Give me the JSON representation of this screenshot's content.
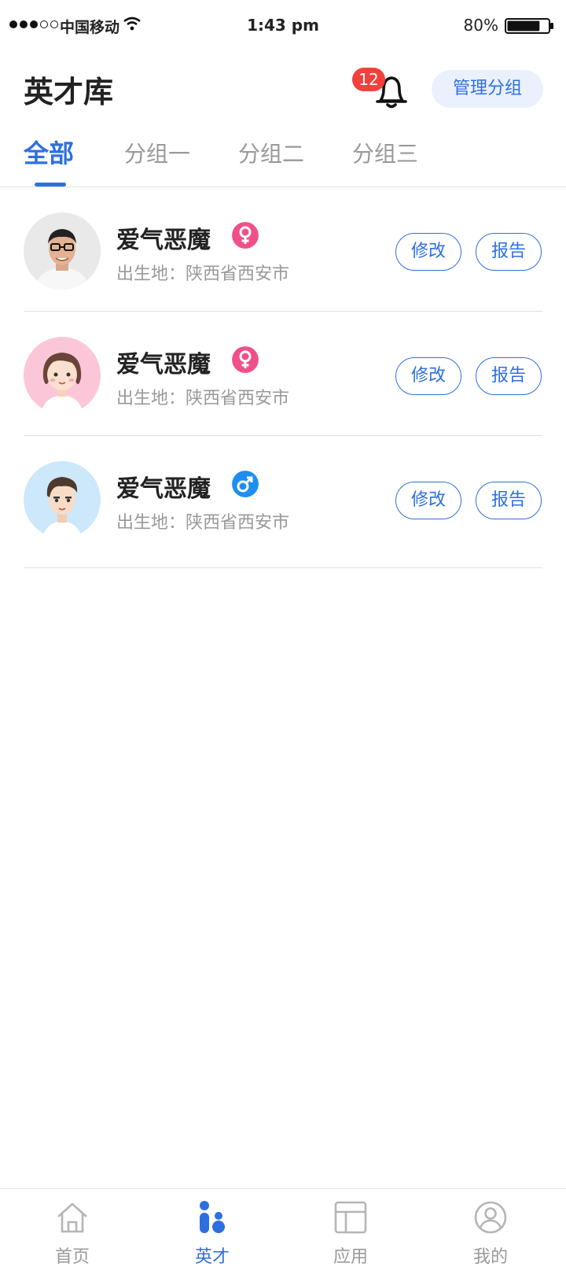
{
  "status_bar": {
    "carrier": "中国移动",
    "time": "1:43 pm",
    "battery": "80%",
    "battery_level": 0.8
  },
  "header": {
    "title": "英才库",
    "notification_count": "12",
    "manage_label": "管理分组"
  },
  "tabs": [
    {
      "label": "全部",
      "active": true
    },
    {
      "label": "分组一",
      "active": false
    },
    {
      "label": "分组二",
      "active": false
    },
    {
      "label": "分组三",
      "active": false
    }
  ],
  "talents": [
    {
      "name": "爱气恶魔",
      "gender": "female",
      "birthplace": "出生地：陕西省西安市",
      "edit_label": "修改",
      "report_label": "报告"
    },
    {
      "name": "爱气恶魔",
      "gender": "female",
      "birthplace": "出生地：陕西省西安市",
      "edit_label": "修改",
      "report_label": "报告"
    },
    {
      "name": "爱气恶魔",
      "gender": "male",
      "birthplace": "出生地：陕西省西安市",
      "edit_label": "修改",
      "report_label": "报告"
    }
  ],
  "bottom_nav": [
    {
      "label": "首页",
      "icon": "home-icon",
      "active": false
    },
    {
      "label": "英才",
      "icon": "talent-icon",
      "active": true
    },
    {
      "label": "应用",
      "icon": "apps-icon",
      "active": false
    },
    {
      "label": "我的",
      "icon": "profile-icon",
      "active": false
    }
  ],
  "colors": {
    "accent": "#2e6fe0",
    "badge": "#f2403d",
    "female": "#f0508a",
    "male": "#1e8ff0"
  }
}
